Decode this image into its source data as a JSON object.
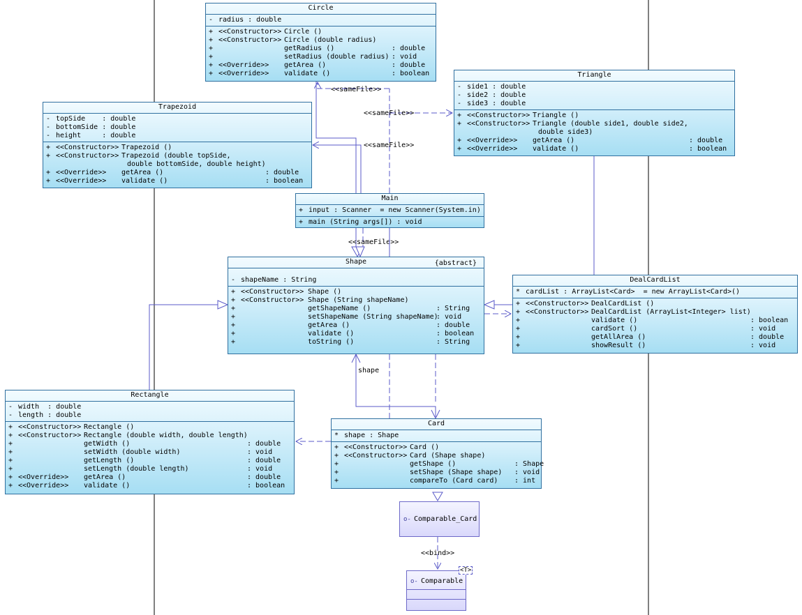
{
  "classes": {
    "circle": {
      "name": "Circle",
      "attributes": [
        {
          "vis": "-",
          "text": "radius : double"
        }
      ],
      "methods": [
        {
          "vis": "+",
          "stereo": "<<Constructor>>",
          "sig": "Circle ()",
          "ret": ""
        },
        {
          "vis": "+",
          "stereo": "<<Constructor>>",
          "sig": "Circle (double radius)",
          "ret": ""
        },
        {
          "vis": "+",
          "stereo": "",
          "sig": "getRadius ()",
          "ret": ": double"
        },
        {
          "vis": "+",
          "stereo": "",
          "sig": "setRadius (double radius)",
          "ret": ": void"
        },
        {
          "vis": "+",
          "stereo": "<<Override>>",
          "sig": "getArea ()",
          "ret": ": double"
        },
        {
          "vis": "+",
          "stereo": "<<Override>>",
          "sig": "validate ()",
          "ret": ": boolean"
        }
      ]
    },
    "triangle": {
      "name": "Triangle",
      "attributes": [
        {
          "vis": "-",
          "text": "side1 : double"
        },
        {
          "vis": "-",
          "text": "side2 : double"
        },
        {
          "vis": "-",
          "text": "side3 : double"
        }
      ],
      "methods": [
        {
          "vis": "+",
          "stereo": "<<Constructor>>",
          "sig": "Triangle ()",
          "ret": ""
        },
        {
          "vis": "+",
          "stereo": "<<Constructor>>",
          "sig": "Triangle (double side1, double side2,",
          "ret": ""
        },
        {
          "vis": "",
          "stereo": "",
          "sig": "double side3)",
          "ret": ""
        },
        {
          "vis": "+",
          "stereo": "<<Override>>",
          "sig": "getArea ()",
          "ret": ": double"
        },
        {
          "vis": "+",
          "stereo": "<<Override>>",
          "sig": "validate ()",
          "ret": ": boolean"
        }
      ]
    },
    "trapezoid": {
      "name": "Trapezoid",
      "attributes": [
        {
          "vis": "-",
          "text": "topSide    : double"
        },
        {
          "vis": "-",
          "text": "bottomSide : double"
        },
        {
          "vis": "-",
          "text": "height     : double"
        }
      ],
      "methods": [
        {
          "vis": "+",
          "stereo": "<<Constructor>>",
          "sig": "Trapezoid ()",
          "ret": ""
        },
        {
          "vis": "+",
          "stereo": "<<Constructor>>",
          "sig": "Trapezoid (double topSide,",
          "ret": ""
        },
        {
          "vis": "",
          "stereo": "",
          "sig": "double bottomSide, double height)",
          "ret": ""
        },
        {
          "vis": "+",
          "stereo": "<<Override>>",
          "sig": "getArea ()",
          "ret": ": double"
        },
        {
          "vis": "+",
          "stereo": "<<Override>>",
          "sig": "validate ()",
          "ret": ": boolean"
        }
      ]
    },
    "main": {
      "name": "Main",
      "attributes": [
        {
          "vis": "+",
          "text": "input : Scanner  = new Scanner(System.in)"
        }
      ],
      "methods": [
        {
          "vis": "+",
          "stereo": "",
          "sig": "main (String args[]) : void",
          "ret": ""
        }
      ]
    },
    "shape": {
      "name": "Shape",
      "modifier": "{abstract}",
      "attributes": [
        {
          "vis": "-",
          "text": "shapeName : String"
        }
      ],
      "methods": [
        {
          "vis": "+",
          "stereo": "<<Constructor>>",
          "sig": "Shape ()",
          "ret": ""
        },
        {
          "vis": "+",
          "stereo": "<<Constructor>>",
          "sig": "Shape (String shapeName)",
          "ret": ""
        },
        {
          "vis": "+",
          "stereo": "",
          "sig": "getShapeName ()",
          "ret": ": String"
        },
        {
          "vis": "+",
          "stereo": "",
          "sig": "setShapeName (String shapeName)",
          "ret": ": void"
        },
        {
          "vis": "+",
          "stereo": "",
          "sig": "getArea ()",
          "ret": ": double"
        },
        {
          "vis": "+",
          "stereo": "",
          "sig": "validate ()",
          "ret": ": boolean"
        },
        {
          "vis": "+",
          "stereo": "",
          "sig": "toString ()",
          "ret": ": String"
        }
      ]
    },
    "dealcardlist": {
      "name": "DealCardList",
      "attributes": [
        {
          "vis": "*",
          "text": "cardList : ArrayList<Card>  = new ArrayList<Card>()"
        }
      ],
      "methods": [
        {
          "vis": "+",
          "stereo": "<<Constructor>>",
          "sig": "DealCardList ()",
          "ret": ""
        },
        {
          "vis": "+",
          "stereo": "<<Constructor>>",
          "sig": "DealCardList (ArrayList<Integer> list)",
          "ret": ""
        },
        {
          "vis": "+",
          "stereo": "",
          "sig": "validate ()",
          "ret": ": boolean"
        },
        {
          "vis": "+",
          "stereo": "",
          "sig": "cardSort ()",
          "ret": ": void"
        },
        {
          "vis": "+",
          "stereo": "",
          "sig": "getAllArea ()",
          "ret": ": double"
        },
        {
          "vis": "+",
          "stereo": "",
          "sig": "showResult ()",
          "ret": ": void"
        }
      ]
    },
    "rectangle": {
      "name": "Rectangle",
      "attributes": [
        {
          "vis": "-",
          "text": "width  : double"
        },
        {
          "vis": "-",
          "text": "length : double"
        }
      ],
      "methods": [
        {
          "vis": "+",
          "stereo": "<<Constructor>>",
          "sig": "Rectangle ()",
          "ret": ""
        },
        {
          "vis": "+",
          "stereo": "<<Constructor>>",
          "sig": "Rectangle (double width, double length)",
          "ret": ""
        },
        {
          "vis": "+",
          "stereo": "",
          "sig": "getWidth ()",
          "ret": ": double"
        },
        {
          "vis": "+",
          "stereo": "",
          "sig": "setWidth (double width)",
          "ret": ": void"
        },
        {
          "vis": "+",
          "stereo": "",
          "sig": "getLength ()",
          "ret": ": double"
        },
        {
          "vis": "+",
          "stereo": "",
          "sig": "setLength (double length)",
          "ret": ": void"
        },
        {
          "vis": "+",
          "stereo": "<<Override>>",
          "sig": "getArea ()",
          "ret": ": double"
        },
        {
          "vis": "+",
          "stereo": "<<Override>>",
          "sig": "validate ()",
          "ret": ": boolean"
        }
      ]
    },
    "card": {
      "name": "Card",
      "attributes": [
        {
          "vis": "*",
          "text": "shape : Shape"
        }
      ],
      "methods": [
        {
          "vis": "+",
          "stereo": "<<Constructor>>",
          "sig": "Card ()",
          "ret": ""
        },
        {
          "vis": "+",
          "stereo": "<<Constructor>>",
          "sig": "Card (Shape shape)",
          "ret": ""
        },
        {
          "vis": "+",
          "stereo": "",
          "sig": "getShape ()",
          "ret": ": Shape"
        },
        {
          "vis": "+",
          "stereo": "",
          "sig": "setShape (Shape shape)",
          "ret": ": void"
        },
        {
          "vis": "+",
          "stereo": "",
          "sig": "compareTo (Card card)",
          "ret": ": int"
        }
      ]
    }
  },
  "interfaces": {
    "comparable_card": {
      "name": "Comparable_Card"
    },
    "comparable": {
      "name": "Comparable",
      "template_param": "<T>"
    }
  },
  "labels": {
    "samefile_circle": "<<sameFile>>",
    "samefile_triangle": "<<sameFile>>",
    "samefile_trapezoid": "<<sameFile>>",
    "samefile_shape": "<<sameFile>>",
    "shape_role": "shape",
    "bind": "<<bind>>"
  },
  "colors": {
    "class_border": "#2f6f9f",
    "connector": "#5a5ac8",
    "interface_border": "#6c68c8"
  }
}
